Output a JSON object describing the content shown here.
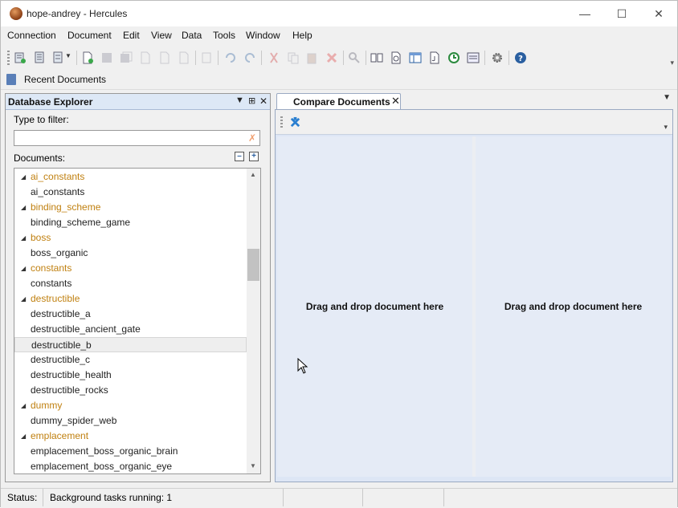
{
  "window": {
    "title": "hope-andrey - Hercules"
  },
  "menu": [
    "Connection",
    "Document",
    "Edit",
    "View",
    "Data",
    "Tools",
    "Window",
    "Help"
  ],
  "recent": {
    "label": "Recent Documents"
  },
  "explorer": {
    "title": "Database Explorer",
    "filter_label": "Type to filter:",
    "filter_value": "",
    "documents_label": "Documents:",
    "tree": [
      {
        "label": "ai_constants",
        "type": "group"
      },
      {
        "label": "ai_constants",
        "type": "doc"
      },
      {
        "label": "binding_scheme",
        "type": "group"
      },
      {
        "label": "binding_scheme_game",
        "type": "doc"
      },
      {
        "label": "boss",
        "type": "group"
      },
      {
        "label": "boss_organic",
        "type": "doc"
      },
      {
        "label": "constants",
        "type": "group"
      },
      {
        "label": "constants",
        "type": "doc"
      },
      {
        "label": "destructible",
        "type": "group"
      },
      {
        "label": "destructible_a",
        "type": "doc"
      },
      {
        "label": "destructible_ancient_gate",
        "type": "doc"
      },
      {
        "label": "destructible_b",
        "type": "doc",
        "selected": true
      },
      {
        "label": "destructible_c",
        "type": "doc"
      },
      {
        "label": "destructible_health",
        "type": "doc"
      },
      {
        "label": "destructible_rocks",
        "type": "doc"
      },
      {
        "label": "dummy",
        "type": "group"
      },
      {
        "label": "dummy_spider_web",
        "type": "doc"
      },
      {
        "label": "emplacement",
        "type": "group"
      },
      {
        "label": "emplacement_boss_organic_brain",
        "type": "doc"
      },
      {
        "label": "emplacement_boss_organic_eye",
        "type": "doc"
      }
    ]
  },
  "compare": {
    "tab_label": "Compare Documents",
    "left_drop": "Drag and drop document here",
    "right_drop": "Drag and drop document here"
  },
  "status": {
    "label": "Status:",
    "text": "Background tasks running: 1"
  }
}
